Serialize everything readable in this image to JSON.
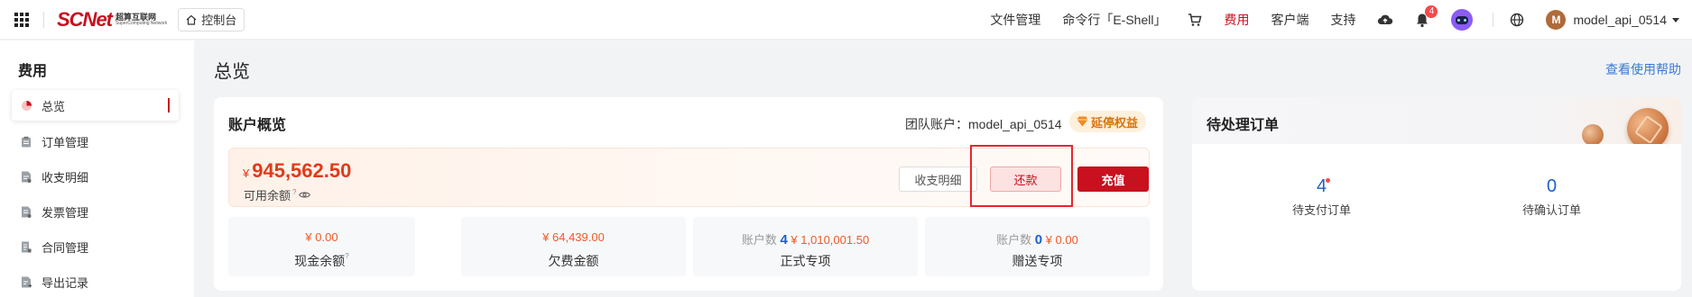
{
  "topbar": {
    "logo_main": "SCNet",
    "logo_cn": "超算互联网",
    "logo_en": "SuperComputing Network",
    "console_label": "控制台",
    "links": [
      "文件管理",
      "命令行「E-Shell」"
    ],
    "fee_label": "费用",
    "client_label": "客户端",
    "support_label": "支持",
    "notification_count": "4",
    "user_initial": "M",
    "username": "model_api_0514"
  },
  "sidebar": {
    "title": "费用",
    "items": [
      {
        "label": "总览",
        "icon": "pie-chart-icon",
        "active": true
      },
      {
        "label": "订单管理",
        "icon": "clipboard-icon"
      },
      {
        "label": "收支明细",
        "icon": "document-icon"
      },
      {
        "label": "发票管理",
        "icon": "invoice-icon"
      },
      {
        "label": "合同管理",
        "icon": "contract-icon"
      },
      {
        "label": "导出记录",
        "icon": "export-icon"
      }
    ]
  },
  "main": {
    "title": "总览",
    "help_link": "查看使用帮助"
  },
  "account": {
    "title": "账户概览",
    "team_label": "团队账户：model_api_0514",
    "vip_label": "延停权益",
    "currency": "¥",
    "balance": "945,562.50",
    "balance_label": "可用余额",
    "detail_button": "收支明细",
    "repay_button": "还款",
    "recharge_button": "充值",
    "stats": [
      {
        "value": "¥ 0.00",
        "label": "现金余额",
        "help": "?"
      },
      {
        "value": "¥ 64,439.00",
        "label": "欠费金额"
      },
      {
        "prefix": "账户数",
        "count": "4",
        "value": "¥ 1,010,001.50",
        "label": "正式专项"
      },
      {
        "prefix": "账户数",
        "count": "0",
        "value": "¥ 0.00",
        "label": "赠送专项"
      }
    ]
  },
  "pending": {
    "title": "待处理订单",
    "items": [
      {
        "count": "4",
        "label": "待支付订单"
      },
      {
        "count": "0",
        "label": "待确认订单"
      }
    ]
  },
  "colors": {
    "brand": "#c8101e",
    "amount": "#ef5a25",
    "link": "#3a7bd5",
    "highlight": "#e8262b"
  }
}
